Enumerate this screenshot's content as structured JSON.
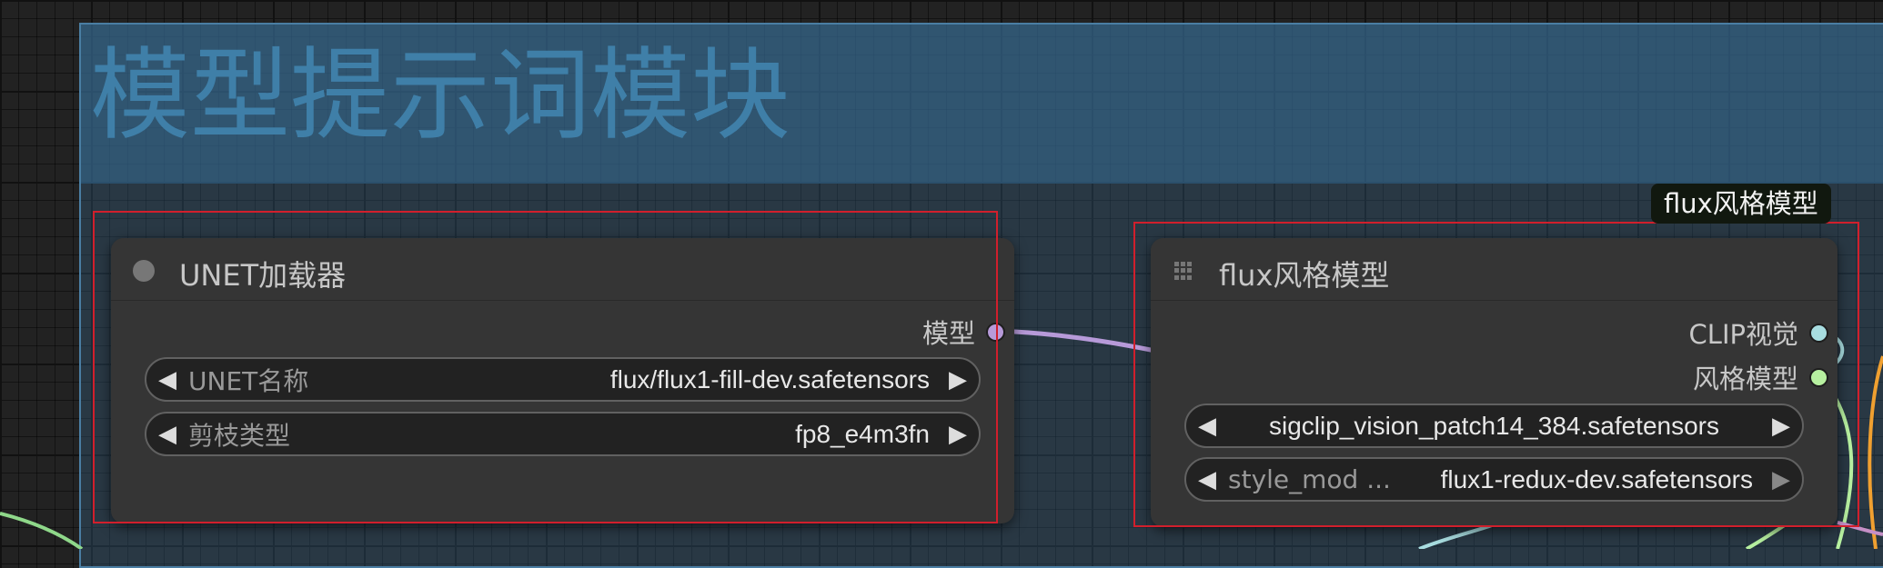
{
  "group": {
    "title": "模型提示词模块"
  },
  "tooltip": {
    "text": "flux风格模型"
  },
  "colors": {
    "model_wire": "#b79ad9",
    "clip_vision_wire": "#a8dde0",
    "style_model_wire": "#b7f0a0",
    "left_wire": "#8fd88a",
    "right_wire": "#f0a030",
    "selection": "#d11f2c"
  },
  "nodes": {
    "unet_loader": {
      "title": "UNET加载器",
      "status_icon": "circle-dot-icon",
      "output_label": "模型",
      "widgets": {
        "unet_name": {
          "label": "UNET名称",
          "value": "flux/flux1-fill-dev.safetensors"
        },
        "weight_dtype": {
          "label": "剪枝类型",
          "value": "fp8_e4m3fn"
        }
      }
    },
    "style_model": {
      "title": "flux风格模型",
      "status_icon": "grid-icon",
      "outputs": {
        "clip_vision": "CLIP视觉",
        "style_model": "风格模型"
      },
      "widgets": {
        "clip_name": {
          "value": "sigclip_vision_patch14_384.safetensors"
        },
        "style_model_name": {
          "label": "style_mod ...",
          "value": "flux1-redux-dev.safetensors"
        }
      }
    }
  }
}
